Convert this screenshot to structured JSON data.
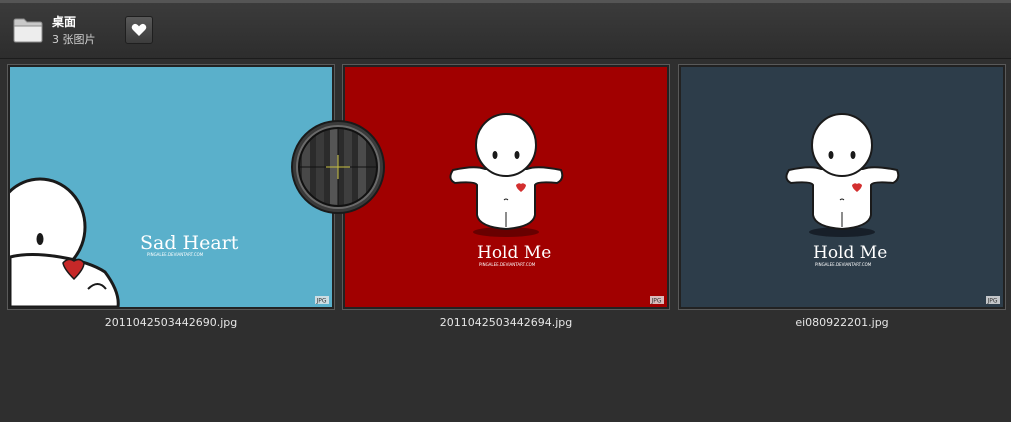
{
  "folder": {
    "name": "桌面",
    "count_label": "3 张图片"
  },
  "favorite_button": {
    "icon": "heart-icon"
  },
  "cursor": {
    "icon": "crosshair-cursor-icon"
  },
  "images": [
    {
      "filename": "2011042503442690.jpg",
      "background": "#5ab0cb",
      "title": "Sad Heart",
      "credit": "PINGALEE.DEVIANTART.COM",
      "badge": "JPG"
    },
    {
      "filename": "2011042503442694.jpg",
      "background": "#a10000",
      "title": "Hold Me",
      "credit": "PINGALEE.DEVIANTART.COM",
      "badge": "JPG"
    },
    {
      "filename": "ei080922201.jpg",
      "background": "#2d3d4a",
      "title": "Hold Me",
      "credit": "PINGALEE.DEVIANTART.COM",
      "badge": "JPG"
    }
  ]
}
